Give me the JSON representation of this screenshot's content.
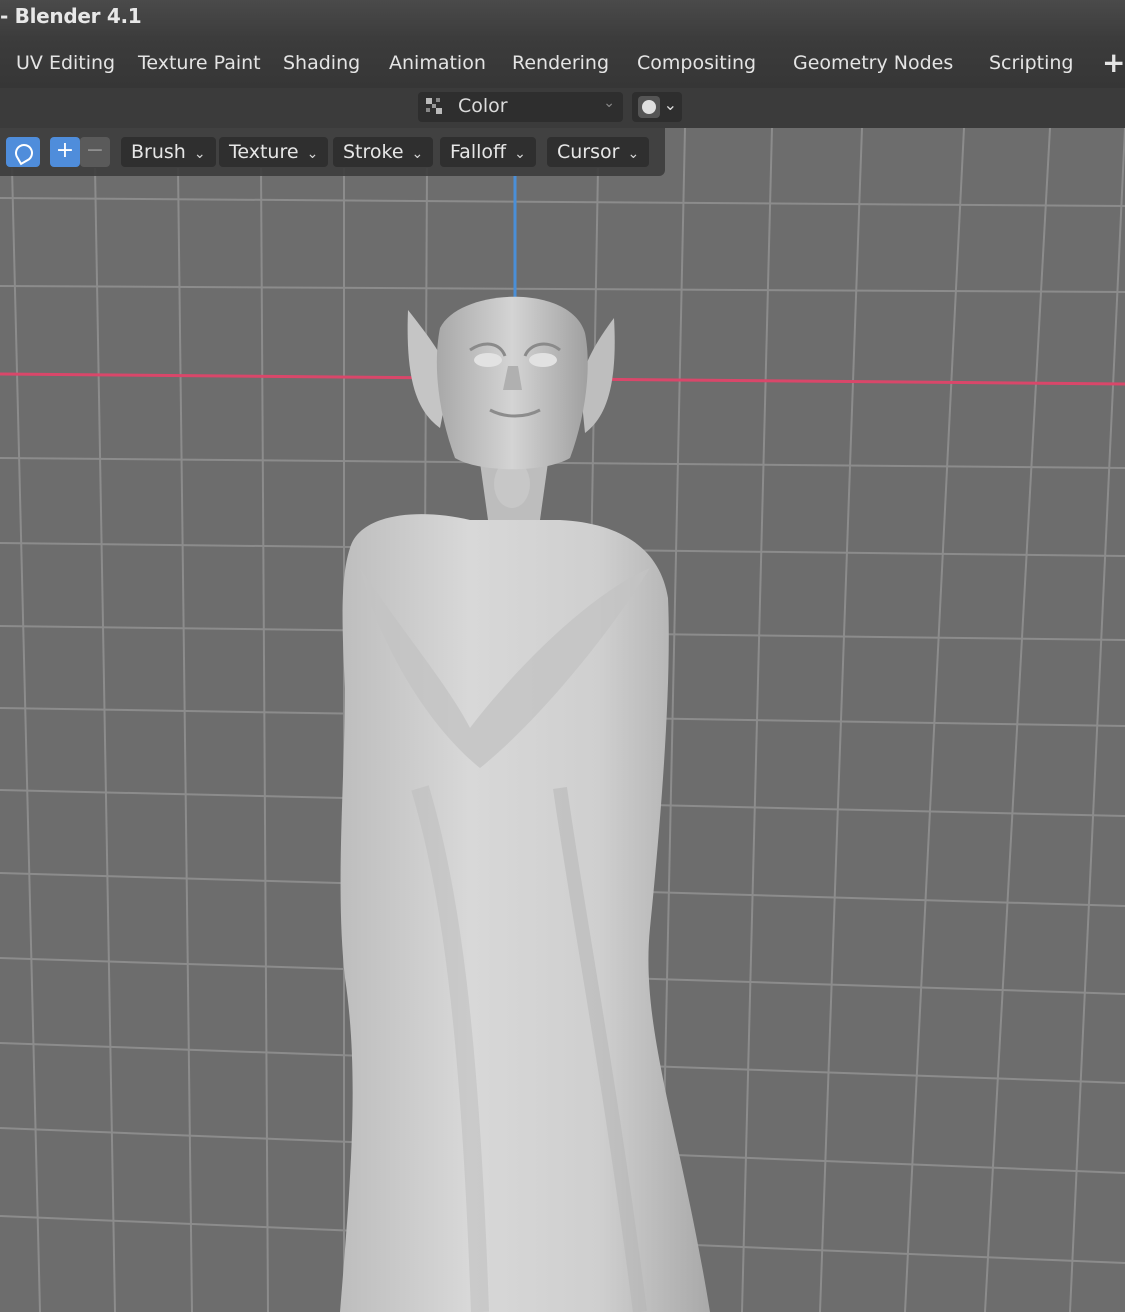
{
  "window": {
    "title": "- Blender 4.1"
  },
  "workspace_tabs": [
    "UV Editing",
    "Texture Paint",
    "Shading",
    "Animation",
    "Rendering",
    "Compositing",
    "Geometry Nodes",
    "Scripting"
  ],
  "add_workspace_label": "+",
  "header": {
    "color_mode": "Color",
    "color_mode_icon": "vertex-color-icon",
    "shading_icon": "sphere-shading-icon"
  },
  "tool_settings": {
    "brush_icon": "paint-brush-icon",
    "add_label": "+",
    "subtract_label": "−",
    "menus": [
      "Brush",
      "Texture",
      "Stroke",
      "Falloff",
      "Cursor"
    ]
  },
  "viewport": {
    "background_color": "#6d6d6d",
    "grid_color": "#8a8a8a",
    "x_axis_color": "#d9476a",
    "z_axis_color": "#4a8fd8",
    "model_color": "#c9c9c9"
  }
}
